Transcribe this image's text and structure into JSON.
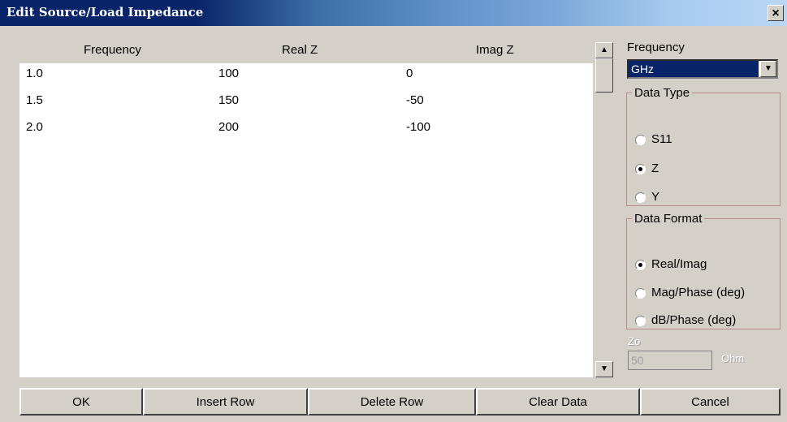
{
  "window": {
    "title": "Edit Source/Load Impedance",
    "close_glyph": "×"
  },
  "table": {
    "columns": [
      "Frequency",
      "Real Z",
      "Imag Z"
    ],
    "rows": [
      [
        "1.0",
        "100",
        "0"
      ],
      [
        "1.5",
        "150",
        "-50"
      ],
      [
        "2.0",
        "200",
        "-100"
      ]
    ]
  },
  "frequency": {
    "label": "Frequency",
    "selected": "GHz"
  },
  "data_type": {
    "label": "Data Type",
    "options": [
      "S11",
      "Z",
      "Y"
    ],
    "selected": "Z"
  },
  "data_format": {
    "label": "Data Format",
    "options": [
      "Real/Imag",
      "Mag/Phase (deg)",
      "dB/Phase (deg)"
    ],
    "selected": "Real/Imag"
  },
  "z0": {
    "label": "Zo",
    "value": "50",
    "unit": "Ohm"
  },
  "buttons": {
    "ok": "OK",
    "insert_row": "Insert Row",
    "delete_row": "Delete Row",
    "clear_data": "Clear Data",
    "cancel": "Cancel"
  }
}
